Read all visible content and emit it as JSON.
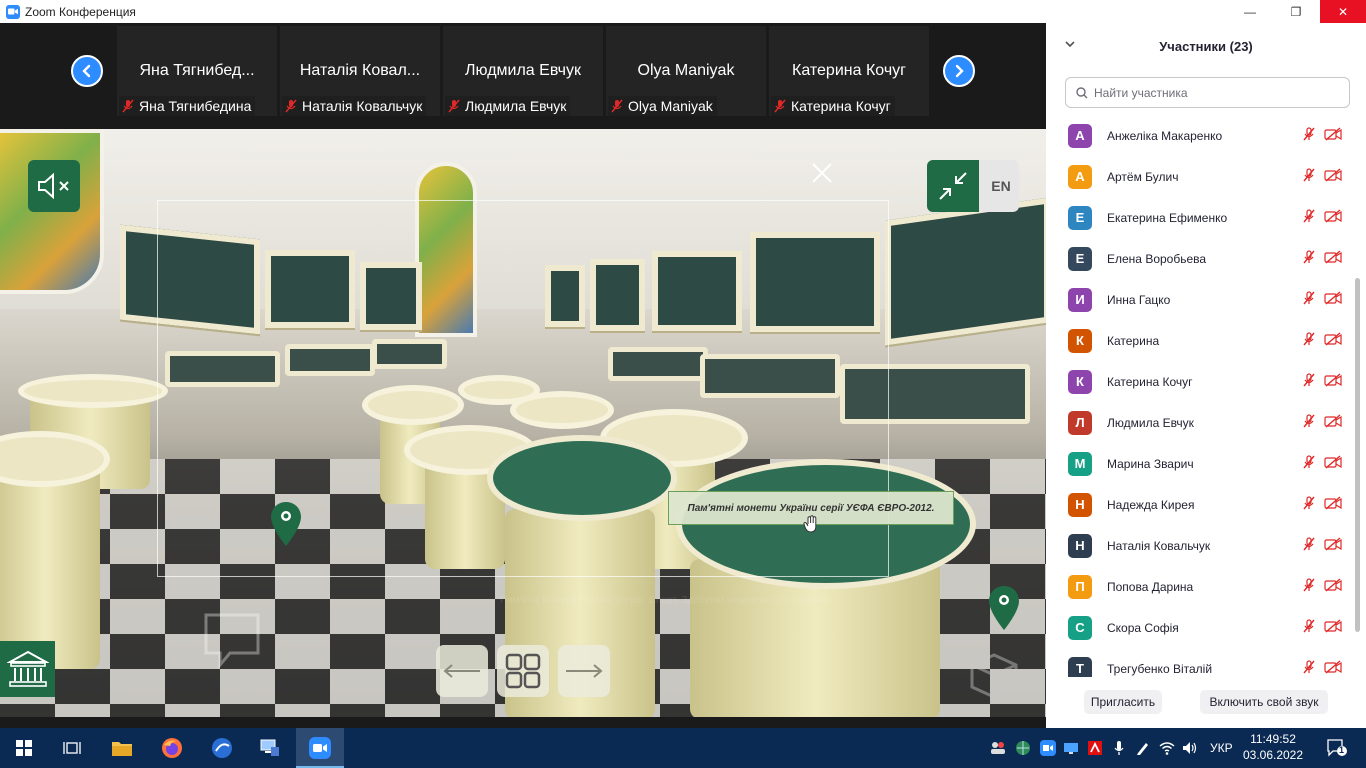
{
  "window": {
    "title": "Zoom Конференция",
    "minimize": "—",
    "restore": "❐",
    "close": "✕"
  },
  "thumbnails": [
    {
      "name": "Яна Тягнибед...",
      "label": "Яна Тягнибедина"
    },
    {
      "name": "Наталія Ковал...",
      "label": "Наталія Ковальчук"
    },
    {
      "name": "Людмила Евчук",
      "label": "Людмила Евчук"
    },
    {
      "name": "Olya Maniyak",
      "label": "Olya Maniyak"
    },
    {
      "name": "Катерина Кочуг",
      "label": "Катерина Кочуг"
    }
  ],
  "share": {
    "language": "EN",
    "tooltip": "Пам'ятні монети України серії УЄФА ЄВРО-2012.",
    "caption": "Пам'ятні монети України (серія: Спорт, Здобутки незалежності України)"
  },
  "participants": {
    "title": "Участники (23)",
    "search_placeholder": "Найти участника",
    "list": [
      {
        "initial": "А",
        "name": "Анжеліка Макаренко",
        "color": "#8e44ad"
      },
      {
        "initial": "А",
        "name": "Артём Булич",
        "color": "#f39c12"
      },
      {
        "initial": "Е",
        "name": "Екатерина Ефименко",
        "color": "#2e86c1"
      },
      {
        "initial": "Е",
        "name": "Елена Воробьева",
        "color": "#34495e"
      },
      {
        "initial": "И",
        "name": "Инна Гацко",
        "color": "#8e44ad"
      },
      {
        "initial": "К",
        "name": "Катерина",
        "color": "#d35400"
      },
      {
        "initial": "К",
        "name": "Катерина Кочуг",
        "color": "#8e44ad"
      },
      {
        "initial": "Л",
        "name": "Людмила Евчук",
        "color": "#c0392b"
      },
      {
        "initial": "М",
        "name": "Марина Зварич",
        "color": "#16a085"
      },
      {
        "initial": "Н",
        "name": "Надежда Кирея",
        "color": "#d35400"
      },
      {
        "initial": "Н",
        "name": "Наталія Ковальчук",
        "color": "#2c3e50"
      },
      {
        "initial": "П",
        "name": "Попова Дарина",
        "color": "#f39c12"
      },
      {
        "initial": "С",
        "name": "Скора Софія",
        "color": "#16a085"
      },
      {
        "initial": "Т",
        "name": "Трегубенко Віталій",
        "color": "#2c3e50"
      }
    ],
    "invite": "Пригласить",
    "unmute": "Включить свой звук"
  },
  "taskbar": {
    "language": "УКР",
    "time": "11:49:52",
    "date": "03.06.2022",
    "notifications": "1"
  }
}
